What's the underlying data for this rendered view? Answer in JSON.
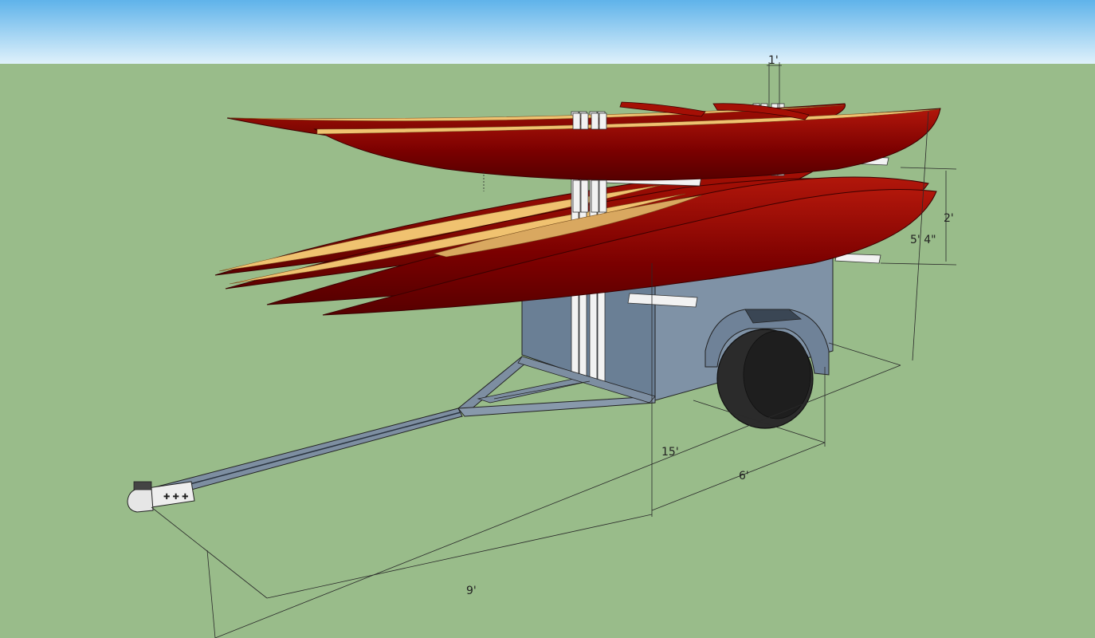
{
  "colors": {
    "sky_top": "#5fb3ea",
    "sky_bottom": "#dff1fb",
    "ground": "#99bc8a",
    "kayak_hull": "#7a0000",
    "kayak_hull_light": "#a50f05",
    "kayak_deck": "#f0c270",
    "kayak_cockpit": "#d9a860",
    "trailer_box": "#6a7f95",
    "trailer_box_light": "#8193a8",
    "frame": "#7d8ea1",
    "wheel": "#2b2b2b",
    "rack": "#f2f2f2",
    "dimension_line": "#2a2a2a"
  },
  "dimensions": {
    "rack_spacing": "1'",
    "kayak_stack_height": "2'",
    "overall_height": "5' 4\"",
    "overall_length": "15'",
    "box_length": "6'",
    "tongue_length": "9'"
  }
}
